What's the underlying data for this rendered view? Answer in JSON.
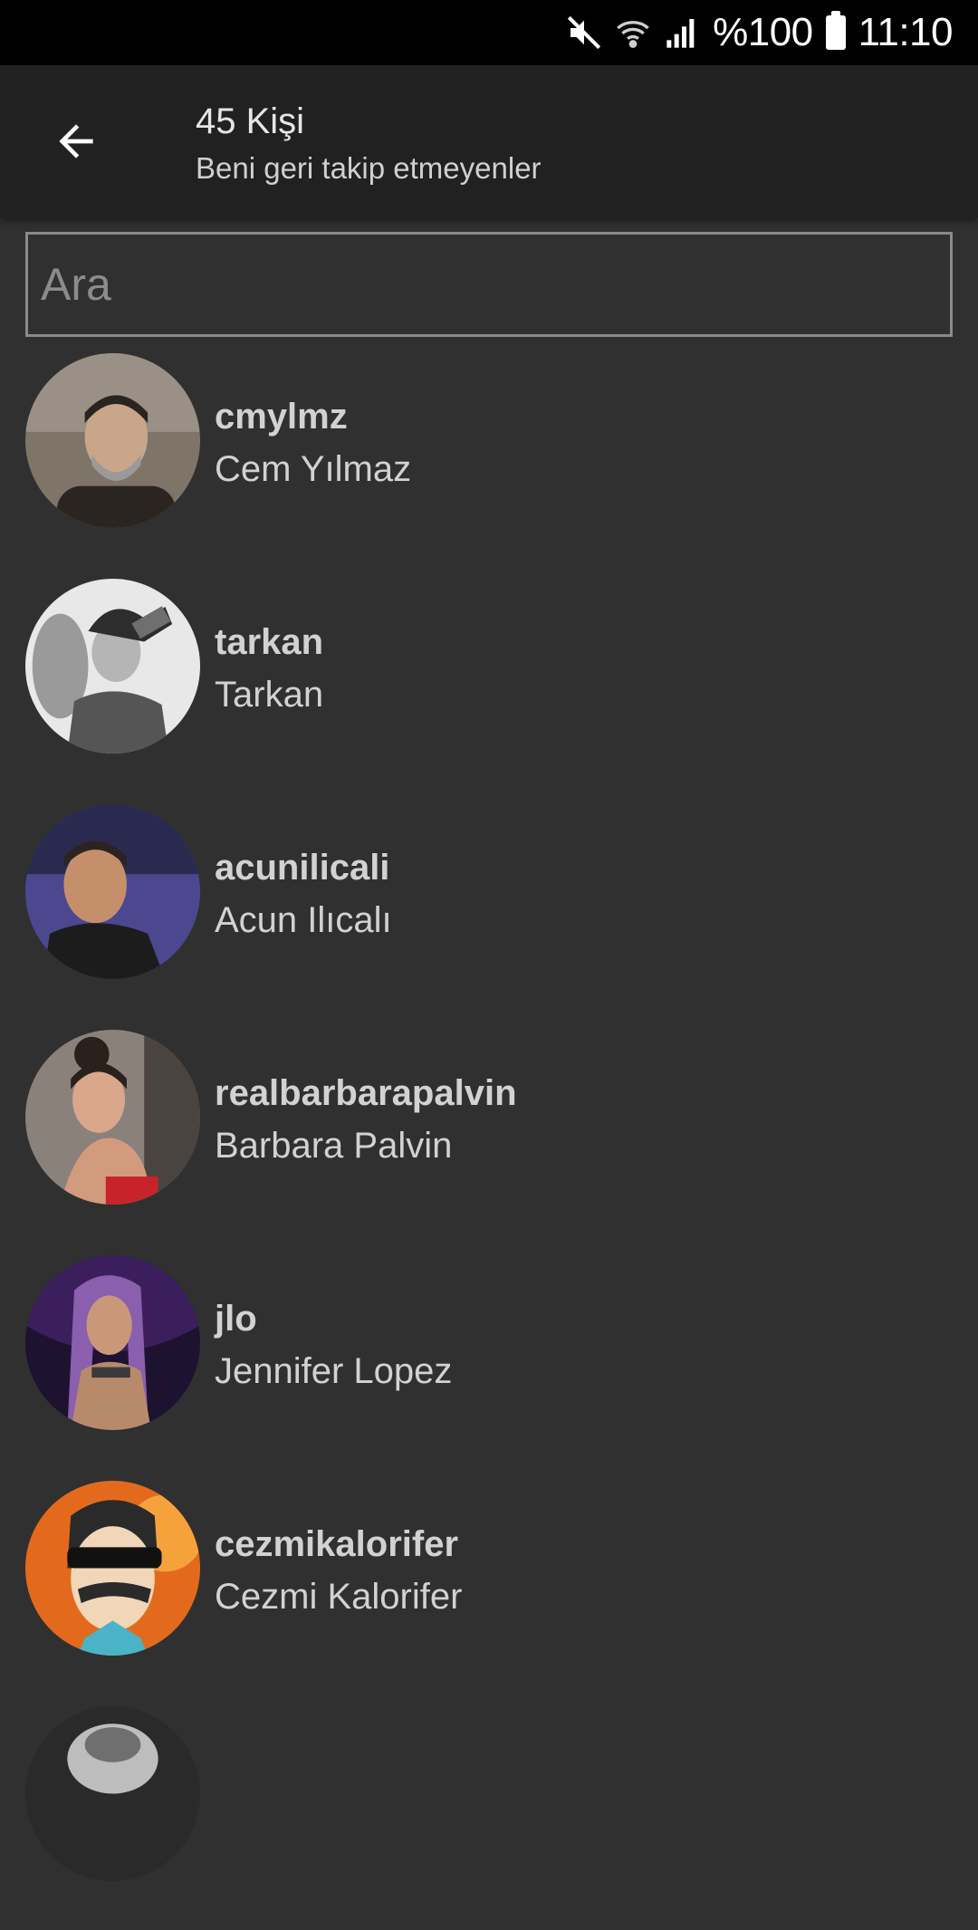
{
  "status_bar": {
    "battery_text": "%100",
    "time": "11:10",
    "icons": [
      "mute-icon",
      "wifi-icon",
      "signal-icon",
      "battery-icon"
    ]
  },
  "header": {
    "title": "45 Kişi",
    "subtitle": "Beni geri takip etmeyenler",
    "back_icon": "arrow-back-icon"
  },
  "search": {
    "placeholder": "Ara",
    "value": ""
  },
  "users": [
    {
      "username": "cmylmz",
      "name": "Cem Yılmaz",
      "avatar_color": "#6b6258"
    },
    {
      "username": "tarkan",
      "name": "Tarkan",
      "avatar_color": "#bdbdbd"
    },
    {
      "username": "acunilicali",
      "name": "Acun Ilıcalı",
      "avatar_color": "#3d3a6e"
    },
    {
      "username": "realbarbarapalvin",
      "name": "Barbara Palvin",
      "avatar_color": "#7a6b63"
    },
    {
      "username": "jlo",
      "name": "Jennifer Lopez",
      "avatar_color": "#3a1f4a"
    },
    {
      "username": "cezmikalorifer",
      "name": "Cezmi Kalorifer",
      "avatar_color": "#e06a1c"
    }
  ],
  "colors": {
    "background": "#303030",
    "app_bar": "#212121",
    "status_bar": "#000000"
  }
}
